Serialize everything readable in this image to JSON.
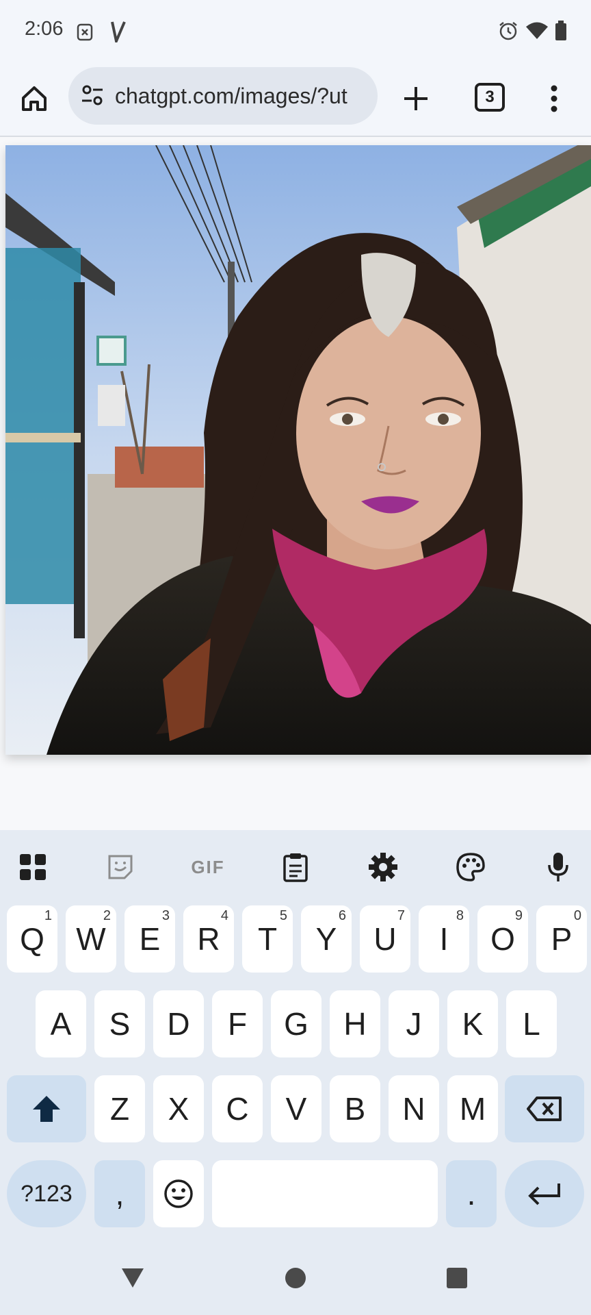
{
  "status_bar": {
    "time": "2:06",
    "left_icons": [
      "notification-x-icon",
      "app-v-icon"
    ],
    "right_icons": [
      "alarm-icon",
      "wifi-icon",
      "battery-icon"
    ]
  },
  "browser": {
    "url": "chatgpt.com/images/?ut",
    "tab_count": "3",
    "icons": [
      "home-icon",
      "site-settings-icon",
      "new-tab-plus-icon",
      "menu-dots-icon"
    ]
  },
  "content": {
    "image": "selfie-photo"
  },
  "keyboard": {
    "toolbar_icons": [
      "apps-grid-icon",
      "sticker-icon",
      "gif-icon",
      "clipboard-icon",
      "settings-gear-icon",
      "palette-icon",
      "mic-icon"
    ],
    "gif_label": "GIF",
    "row1": [
      {
        "label": "Q",
        "hint": "1"
      },
      {
        "label": "W",
        "hint": "2"
      },
      {
        "label": "E",
        "hint": "3"
      },
      {
        "label": "R",
        "hint": "4"
      },
      {
        "label": "T",
        "hint": "5"
      },
      {
        "label": "Y",
        "hint": "6"
      },
      {
        "label": "U",
        "hint": "7"
      },
      {
        "label": "I",
        "hint": "8"
      },
      {
        "label": "O",
        "hint": "9"
      },
      {
        "label": "P",
        "hint": "0"
      }
    ],
    "row2": [
      "A",
      "S",
      "D",
      "F",
      "G",
      "H",
      "J",
      "K",
      "L"
    ],
    "row3": [
      "Z",
      "X",
      "C",
      "V",
      "B",
      "N",
      "M"
    ],
    "bottom": {
      "symbols_label": "?123",
      "comma_label": ",",
      "period_label": "."
    },
    "accent_color": "#cfdff0"
  },
  "nav_bar": {
    "icons": [
      "back-triangle-icon",
      "home-circle-icon",
      "recents-square-icon"
    ]
  }
}
